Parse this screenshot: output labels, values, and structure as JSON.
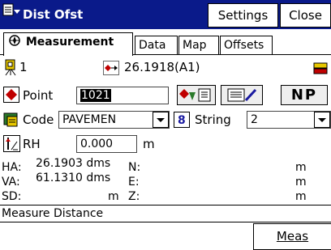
{
  "titlebar": {
    "title": "Dist Ofst",
    "settings_label": "Settings",
    "close_label": "Close"
  },
  "tabs": [
    {
      "label": "Measurement",
      "active": true
    },
    {
      "label": "Data",
      "active": false
    },
    {
      "label": "Map",
      "active": false
    },
    {
      "label": "Offsets",
      "active": false
    }
  ],
  "info": {
    "instrument_number": "1",
    "backsight_value": "26.1918(A1)"
  },
  "point": {
    "label": "Point",
    "value": "1021",
    "np_label": "NP"
  },
  "code": {
    "label": "Code",
    "value": "PAVEMEN",
    "string_label": "String",
    "string_value": "2"
  },
  "rh": {
    "label": "RH",
    "value": "0.000",
    "unit": "m"
  },
  "readouts": {
    "ha_label": "HA:",
    "ha_value": "26.1903 dms",
    "va_label": "VA:",
    "va_value": "61.1310 dms",
    "sd_label": "SD:",
    "sd_unit": "m",
    "n_label": "N:",
    "n_unit": "m",
    "e_label": "E:",
    "e_unit": "m",
    "z_label": "Z:",
    "z_unit": "m"
  },
  "status_text": "Measure Distance",
  "meas_button": "Meas",
  "colors": {
    "titlebar": "#0a1a8a",
    "accent_red": "#c00000",
    "icon_yellow": "#e8c800"
  }
}
